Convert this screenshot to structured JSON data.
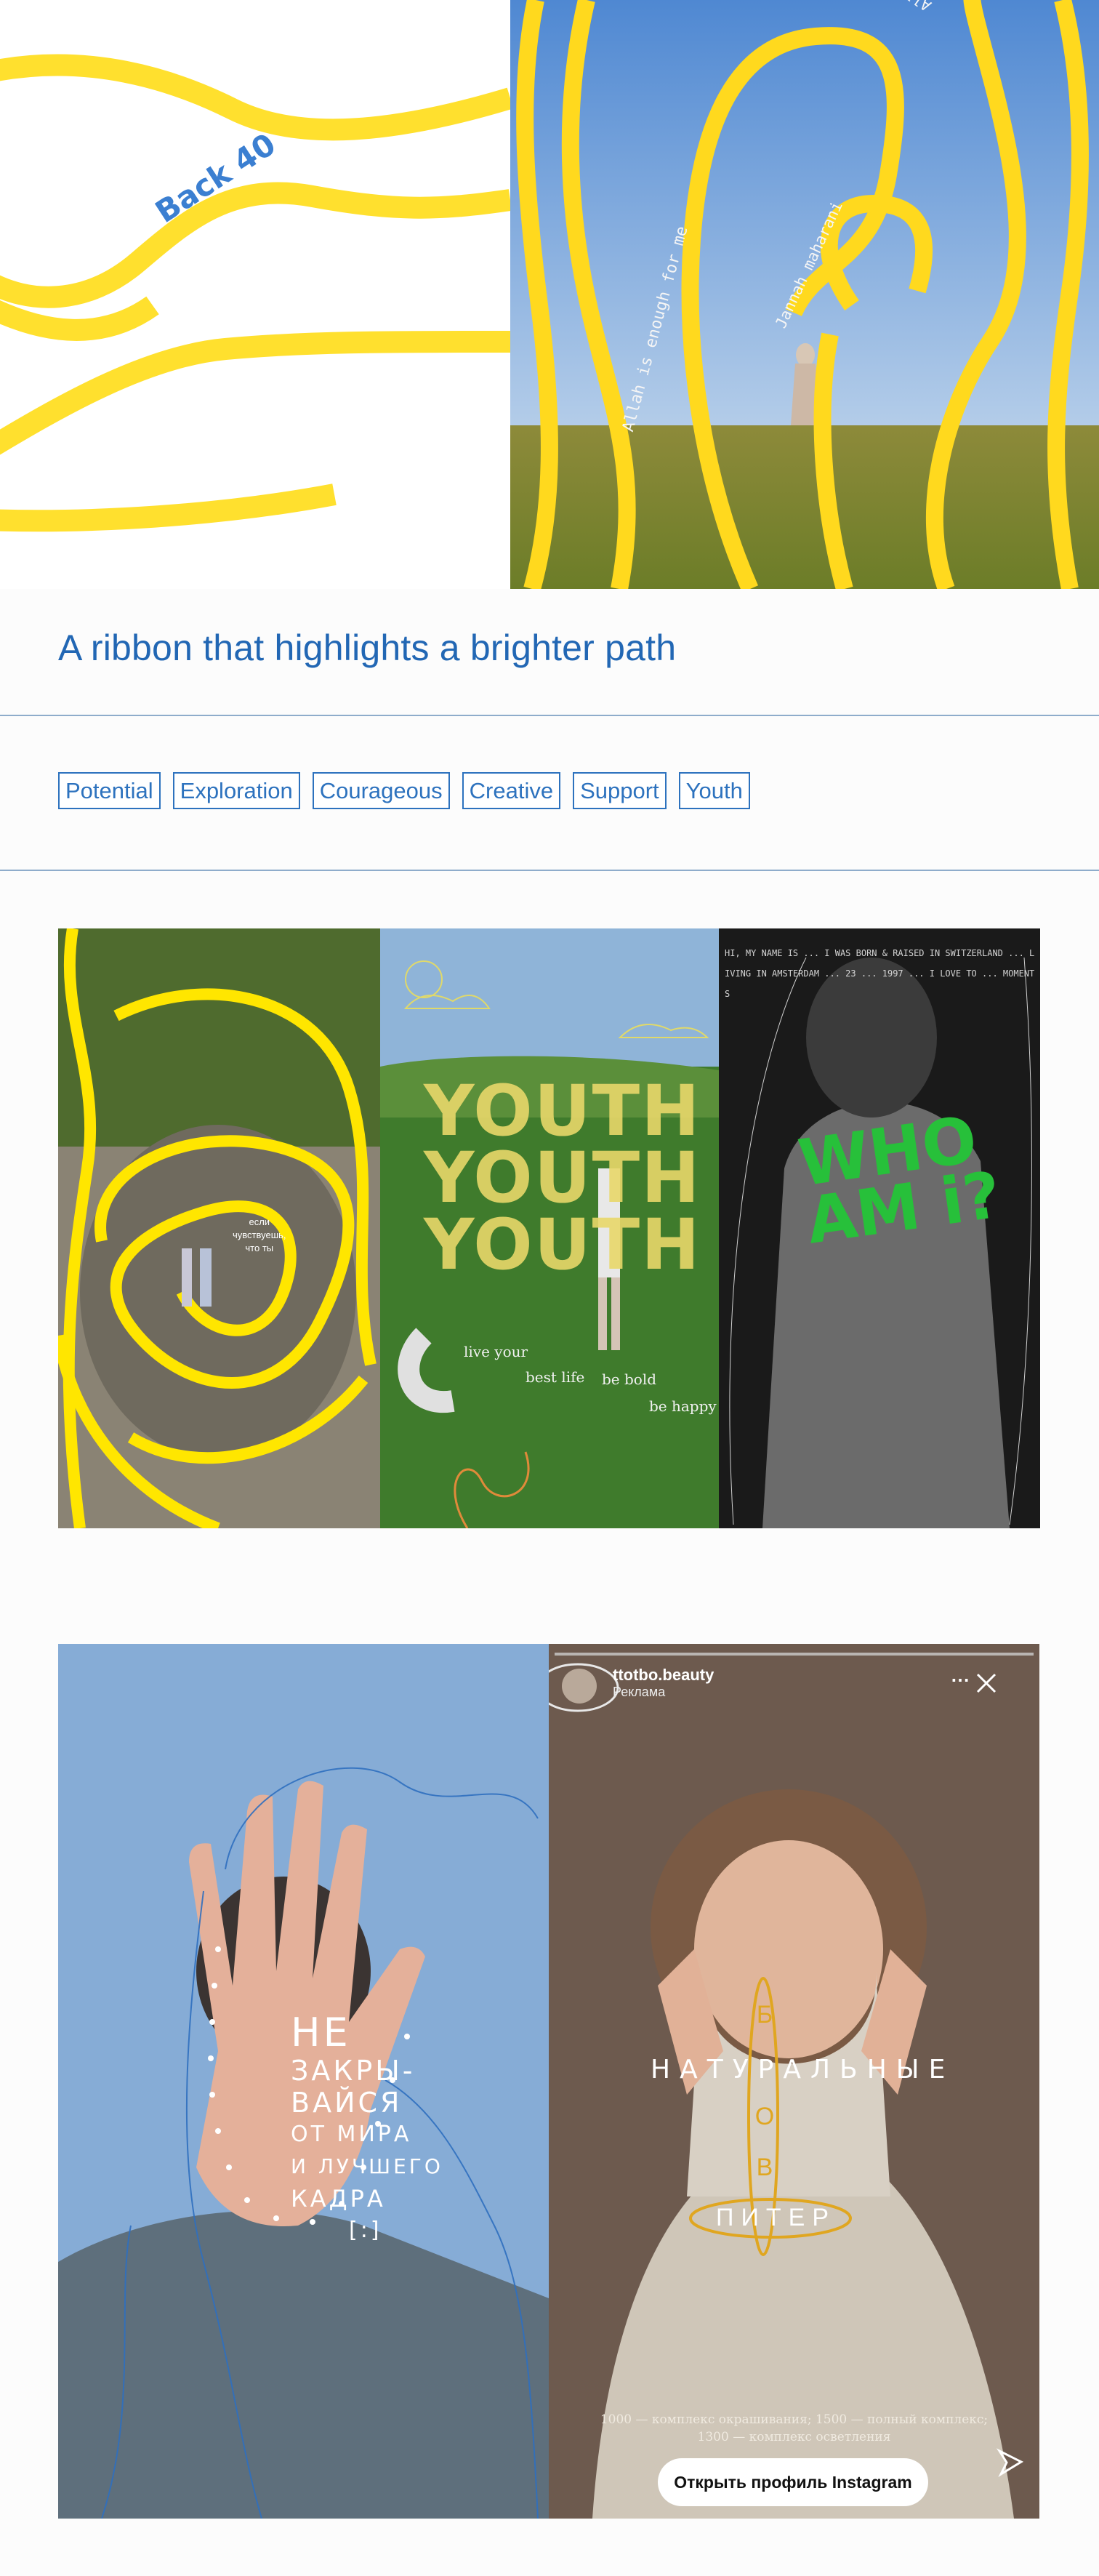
{
  "hero": {
    "badge_text": "Back 40",
    "arc_left": "Allah is enough for me",
    "arc_mid": "Jannah maharani",
    "arc_top": "Allah is enough"
  },
  "headline": "A ribbon that highlights a brighter path",
  "tags": [
    "Potential",
    "Exploration",
    "Courageous",
    "Creative",
    "Support",
    "Youth"
  ],
  "gallery": {
    "panel1_caption": [
      "если",
      "чувствуешь,",
      "что ты"
    ],
    "panel2_word": "YOUTH",
    "panel2_notes": [
      "live your",
      "best life",
      "be bold",
      "be happy"
    ],
    "panel3_title_1": "WHO",
    "panel3_title_2": "AM i?",
    "panel3_scribble": "HI, MY NAME IS ... I WAS BORN & RAISED IN SWITZERLAND ... LIVING IN AMSTERDAM ... 23 ... 1997 ... I LOVE TO ... MOMENTS"
  },
  "hand_story": {
    "lines": [
      "НЕ",
      "ЗАКРЫ-",
      "ВАЙСЯ",
      "ОТ МИРА",
      "И ЛУЧШЕГО",
      "КАДРА",
      "[:]"
    ]
  },
  "insta_story": {
    "username": "ttotbo.beauty",
    "sponsored": "Реклама",
    "more_icon": "⋯",
    "close_icon": "✕",
    "overlay_word": "НАТУРАЛЬНЫЕ",
    "letters": [
      "Б",
      "Р",
      "О",
      "В"
    ],
    "city": "ПИТЕР",
    "price_line_1": "1000 — комплекс окрашивания; 1500 — полный комплекс;",
    "price_line_2": "1300 — комплекс осветления",
    "cta": "Открыть профиль Instagram",
    "send_icon": "paper-plane"
  },
  "colors": {
    "ribbon_yellow": "#ffe02e",
    "brand_blue": "#2267b4",
    "rule_blue": "#8eaccb",
    "neon_green": "#27c03a"
  }
}
